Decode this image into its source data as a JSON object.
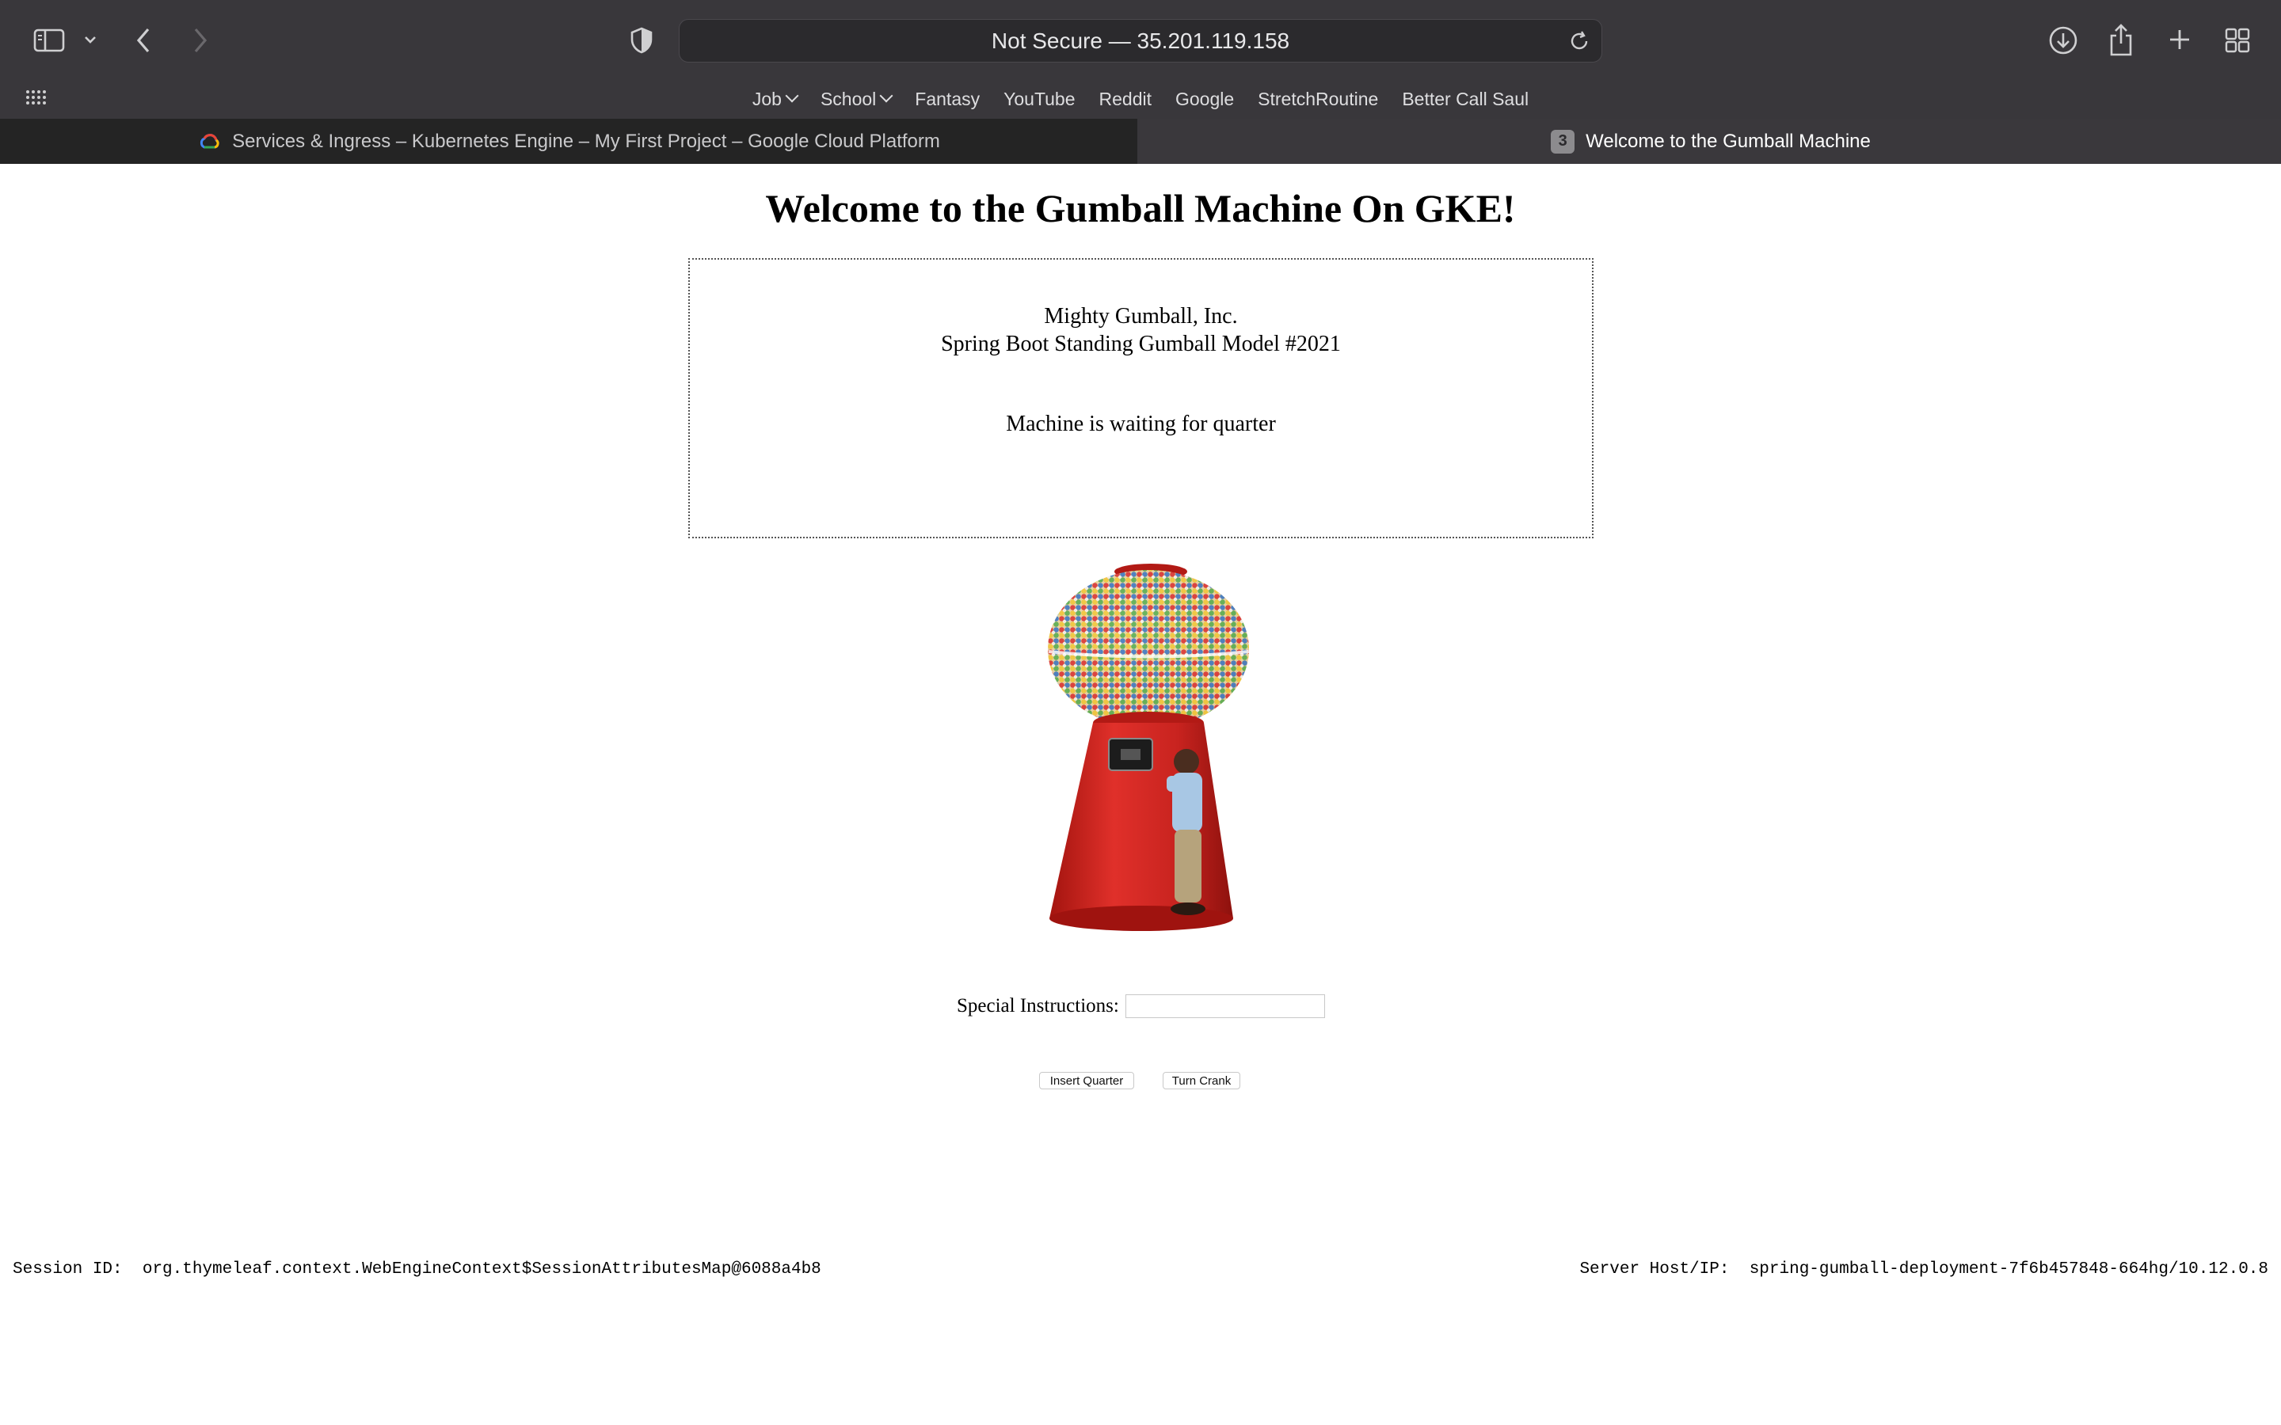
{
  "browser": {
    "url_display": "Not Secure — 35.201.119.158",
    "bookmarks": [
      {
        "label": "Job",
        "has_menu": true
      },
      {
        "label": "School",
        "has_menu": true
      },
      {
        "label": "Fantasy",
        "has_menu": false
      },
      {
        "label": "YouTube",
        "has_menu": false
      },
      {
        "label": "Reddit",
        "has_menu": false
      },
      {
        "label": "Google",
        "has_menu": false
      },
      {
        "label": "StretchRoutine",
        "has_menu": false
      },
      {
        "label": "Better Call Saul",
        "has_menu": false
      }
    ],
    "tabs": [
      {
        "title": "Services & Ingress – Kubernetes Engine – My First Project – Google Cloud Platform",
        "active": false,
        "icon": "google-cloud-icon"
      },
      {
        "title": "Welcome to the Gumball Machine",
        "active": true,
        "badge": "3"
      }
    ]
  },
  "page": {
    "title": "Welcome to the Gumball Machine On GKE!",
    "company": "Mighty Gumball, Inc.",
    "model": "Spring Boot Standing Gumball Model #2021",
    "status": "Machine is waiting for quarter",
    "instructions_label": "Special Instructions:",
    "instructions_value": "",
    "insert_quarter_label": "Insert Quarter",
    "turn_crank_label": "Turn Crank",
    "session_label": "Session ID:",
    "session_value": "org.thymeleaf.context.WebEngineContext$SessionAttributesMap@6088a4b8",
    "server_label": "Server Host/IP:",
    "server_value": "spring-gumball-deployment-7f6b457848-664hg/10.12.0.8"
  },
  "colors": {
    "chrome_bg": "#39373b",
    "inactive_tab_bg": "#242424",
    "machine_red": "#c8231f"
  }
}
